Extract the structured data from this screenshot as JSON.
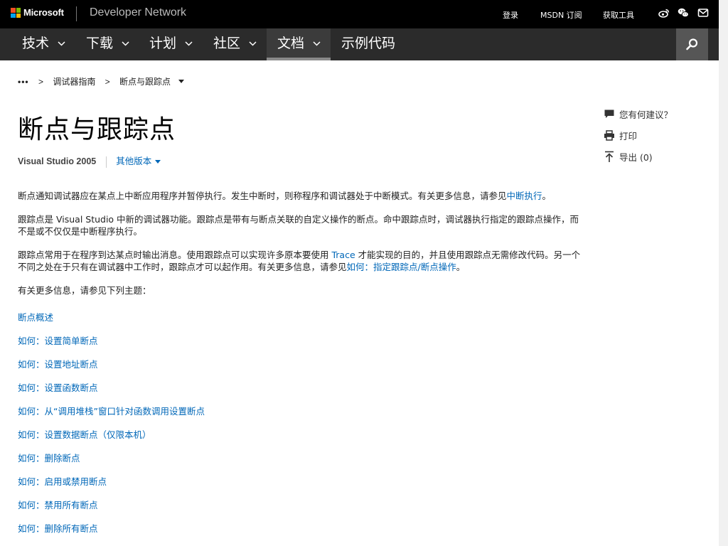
{
  "header": {
    "brand": "Microsoft",
    "site_name": "Developer Network",
    "links": {
      "login": "登录",
      "msdn_subscription": "MSDN 订阅",
      "get_tools": "获取工具"
    },
    "social_icons": [
      "weibo-icon",
      "wechat-icon",
      "email-icon"
    ]
  },
  "nav": {
    "items": [
      {
        "label": "技术",
        "has_dropdown": true
      },
      {
        "label": "下载",
        "has_dropdown": true
      },
      {
        "label": "计划",
        "has_dropdown": true
      },
      {
        "label": "社区",
        "has_dropdown": true
      },
      {
        "label": "文档",
        "has_dropdown": true,
        "active": true
      },
      {
        "label": "示例代码",
        "has_dropdown": false
      }
    ],
    "search_icon": "search-icon"
  },
  "breadcrumb": {
    "ellipsis": "•••",
    "separator": ">",
    "items": [
      "调试器指南",
      "断点与跟踪点"
    ]
  },
  "page": {
    "title": "断点与跟踪点",
    "version": "Visual Studio 2005",
    "other_versions": "其他版本"
  },
  "content": {
    "p1_text": "断点通知调试器应在某点上中断应用程序并暂停执行。发生中断时，则称程序和调试器处于中断模式。有关更多信息，请参见",
    "p1_link": "中断执行",
    "p1_end": "。",
    "p2_text": "跟踪点是 Visual Studio 中新的调试器功能。跟踪点是带有与断点关联的自定义操作的断点。命中跟踪点时，调试器执行指定的跟踪点操作，而不是或不仅仅是中断程序执行。",
    "p3_text_a": "跟踪点常用于在程序到达某点时输出消息。使用跟踪点可以实现许多原本要使用 ",
    "p3_link_trace": "Trace",
    "p3_text_b": " 才能实现的目的，并且使用跟踪点无需修改代码。另一个不同之处在于只有在调试器中工作时，跟踪点才可以起作用。有关更多信息，请参见",
    "p3_link": "如何：指定跟踪点/断点操作",
    "p3_end": "。",
    "p4_text": "有关更多信息，请参见下列主题：",
    "topic_links": [
      "断点概述",
      "如何：设置简单断点",
      "如何：设置地址断点",
      "如何：设置函数断点",
      "如何：从“调用堆栈”窗口针对函数调用设置断点",
      "如何：设置数据断点（仅限本机）",
      "如何：删除断点",
      "如何：启用或禁用断点",
      "如何：禁用所有断点",
      "如何：删除所有断点"
    ]
  },
  "sidebar": {
    "feedback": "您有何建议？",
    "print": "打印",
    "export": "导出 (0)"
  },
  "colors": {
    "link": "#0067b8",
    "topbar_bg": "#000000",
    "navbar_bg": "#2b2b2b",
    "search_bg": "#565656"
  }
}
